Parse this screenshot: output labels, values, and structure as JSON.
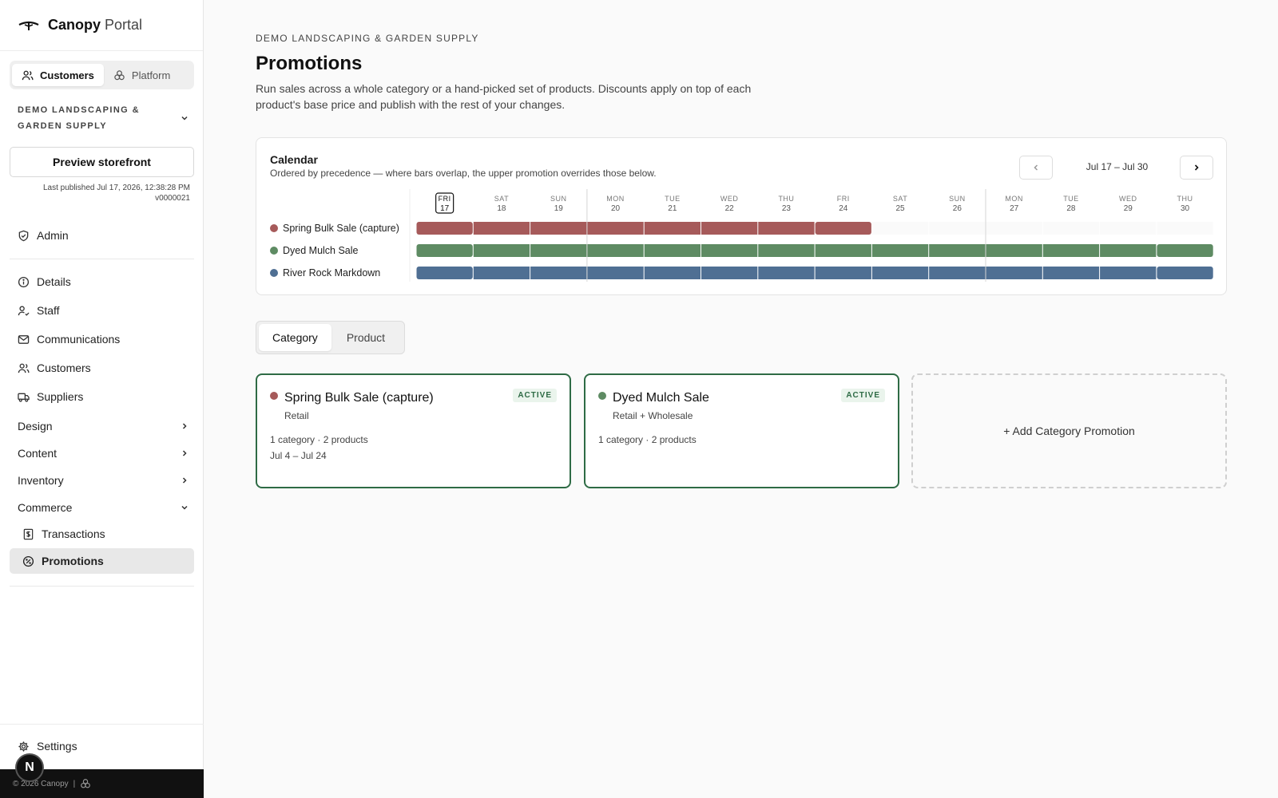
{
  "brand": {
    "name_bold": "Canopy",
    "name_light": "Portal"
  },
  "switcher": {
    "customers": "Customers",
    "platform": "Platform"
  },
  "org": {
    "name": "Demo Landscaping & Garden Supply"
  },
  "preview": {
    "label": "Preview storefront",
    "published_line1": "Last published Jul 17, 2026, 12:38:28 PM",
    "published_line2": "v0000021"
  },
  "nav": {
    "admin": "Admin",
    "details": "Details",
    "staff": "Staff",
    "communications": "Communications",
    "customers": "Customers",
    "suppliers": "Suppliers",
    "design": "Design",
    "content": "Content",
    "inventory": "Inventory",
    "commerce": "Commerce",
    "transactions": "Transactions",
    "promotions": "Promotions",
    "settings": "Settings"
  },
  "footer": {
    "copyright": "© 2026 Canopy",
    "separator": "|",
    "badge": "N"
  },
  "page": {
    "eyebrow": "Demo Landscaping & Garden Supply",
    "title": "Promotions",
    "description": "Run sales across a whole category or a hand-picked set of products. Discounts apply on top of each product's base price and publish with the rest of your changes."
  },
  "calendar": {
    "title": "Calendar",
    "subtitle": "Ordered by precedence — where bars overlap, the upper promotion overrides those below.",
    "range": "Jul 17 – Jul 30",
    "today_index": 0,
    "days": [
      {
        "dow": "FRI",
        "day": "17"
      },
      {
        "dow": "SAT",
        "day": "18"
      },
      {
        "dow": "SUN",
        "day": "19"
      },
      {
        "dow": "MON",
        "day": "20"
      },
      {
        "dow": "TUE",
        "day": "21"
      },
      {
        "dow": "WED",
        "day": "22"
      },
      {
        "dow": "THU",
        "day": "23"
      },
      {
        "dow": "FRI",
        "day": "24"
      },
      {
        "dow": "SAT",
        "day": "25"
      },
      {
        "dow": "SUN",
        "day": "26"
      },
      {
        "dow": "MON",
        "day": "27"
      },
      {
        "dow": "TUE",
        "day": "28"
      },
      {
        "dow": "WED",
        "day": "29"
      },
      {
        "dow": "THU",
        "day": "30"
      }
    ],
    "rows": [
      {
        "name": "Spring Bulk Sale (capture)",
        "color": "#a65a5a",
        "active_days": 8
      },
      {
        "name": "Dyed Mulch Sale",
        "color": "#5e8b63",
        "active_days": 14
      },
      {
        "name": "River Rock Markdown",
        "color": "#4f6f93",
        "active_days": 14
      }
    ]
  },
  "tabs": {
    "category": "Category",
    "product": "Product"
  },
  "cards": [
    {
      "title": "Spring Bulk Sale (capture)",
      "subtitle": "Retail",
      "badge": "ACTIVE",
      "meta1": "1 category · 2 products",
      "meta2": "Jul 4 – Jul 24",
      "color": "#a65a5a"
    },
    {
      "title": "Dyed Mulch Sale",
      "subtitle": "Retail + Wholesale",
      "badge": "ACTIVE",
      "meta1": "1 category · 2 products",
      "meta2": "",
      "color": "#5e8b63"
    }
  ],
  "add_card": {
    "label": "+ Add Category Promotion"
  }
}
